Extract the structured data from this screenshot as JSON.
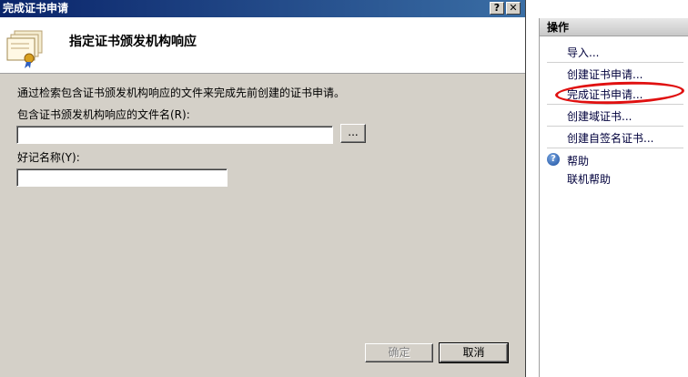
{
  "dialog": {
    "title": "完成证书申请",
    "help_btn": "?",
    "close_btn": "✕",
    "header_title": "指定证书颁发机构响应",
    "description": "通过检索包含证书颁发机构响应的文件来完成先前创建的证书申请。",
    "file_label": "包含证书颁发机构响应的文件名(R):",
    "file_value": "",
    "browse_label": "...",
    "friendly_label": "好记名称(Y):",
    "friendly_value": "",
    "ok_label": "确定",
    "cancel_label": "取消"
  },
  "actions": {
    "header": "操作",
    "items": [
      {
        "label": "导入..."
      },
      {
        "label": "创建证书申请..."
      },
      {
        "label": "完成证书申请..."
      },
      {
        "label": "创建域证书..."
      },
      {
        "label": "创建自签名证书..."
      }
    ],
    "help": "帮助",
    "online_help": "联机帮助"
  }
}
